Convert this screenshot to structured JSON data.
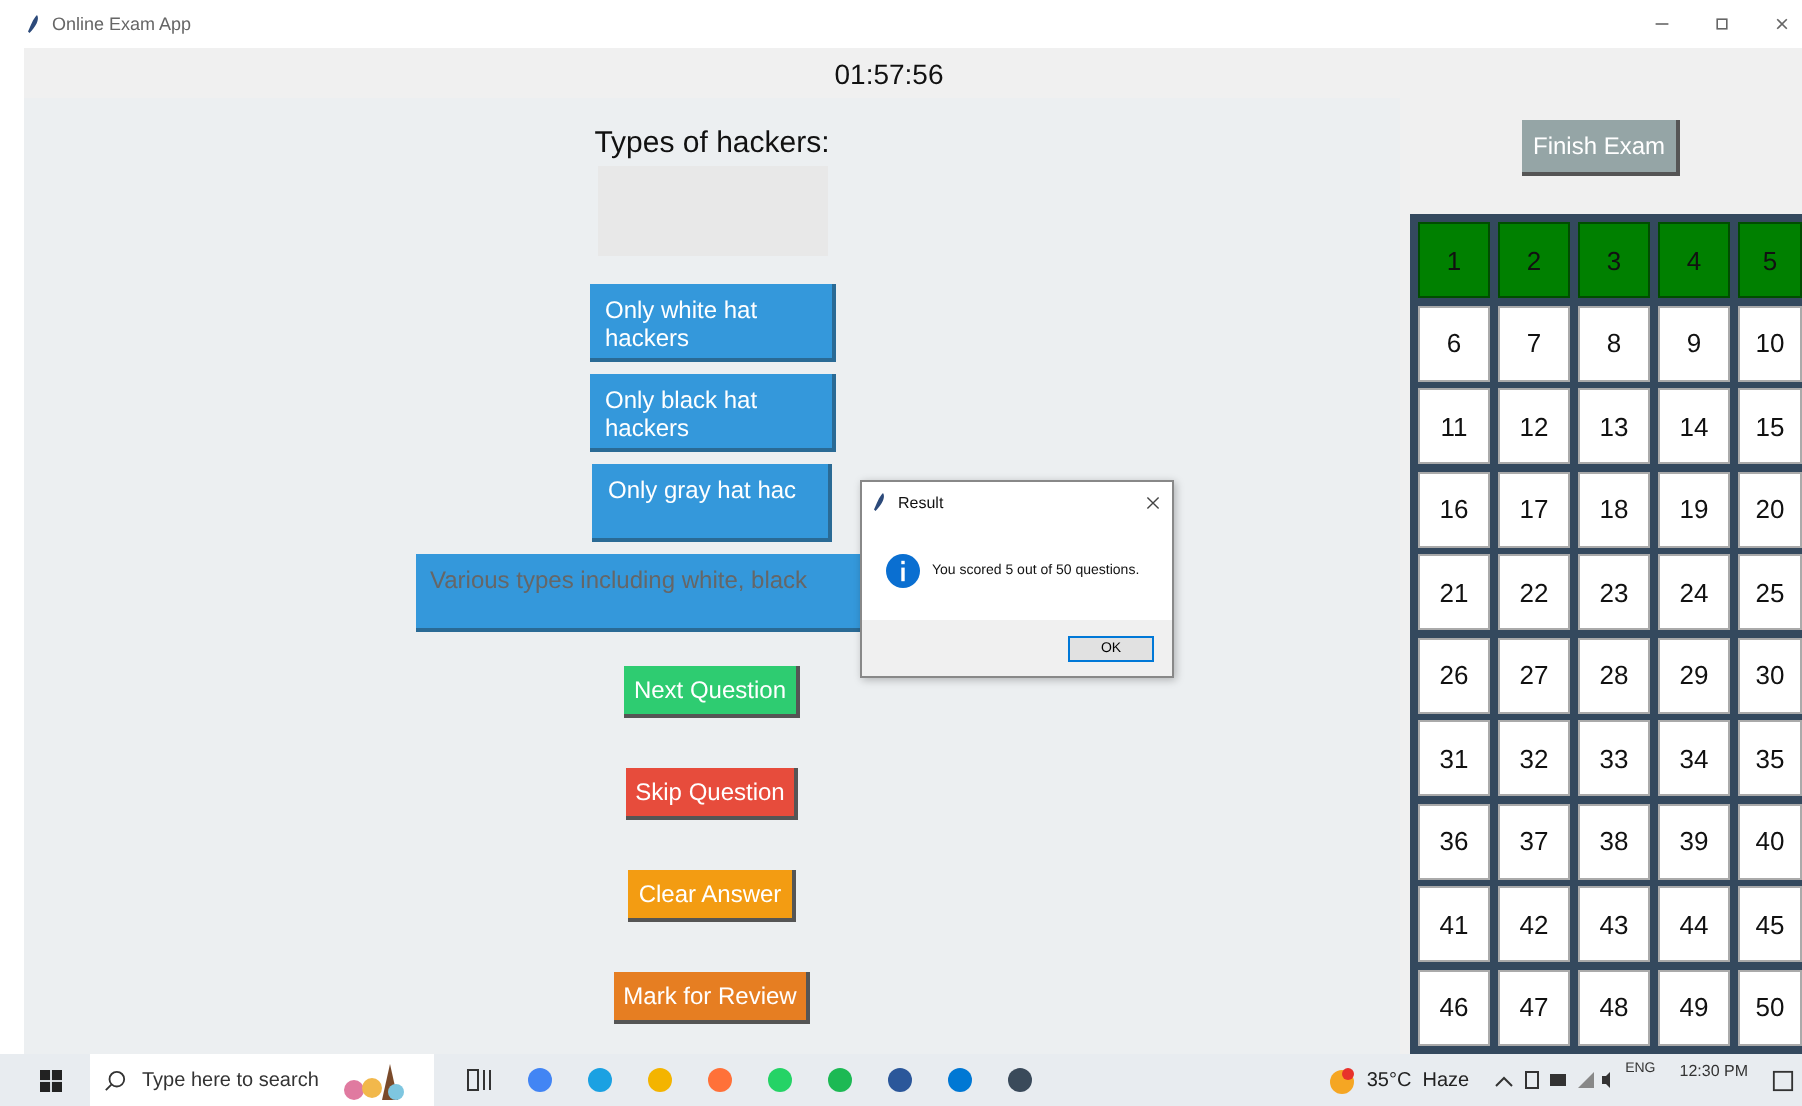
{
  "window": {
    "title": "Online Exam App"
  },
  "timer": "01:57:56",
  "question": "Types of hackers:",
  "options": [
    {
      "label": "Only white hat hackers"
    },
    {
      "label": "Only black hat hackers"
    },
    {
      "label": "Only gray hat hac"
    },
    {
      "label": "Various types including white, black"
    }
  ],
  "actions": [
    {
      "label": "Next Question",
      "kind": "next"
    },
    {
      "label": "Skip Question",
      "kind": "skip"
    },
    {
      "label": "Clear Answer",
      "kind": "clear"
    },
    {
      "label": "Mark for Review",
      "kind": "mark"
    }
  ],
  "finish_button": "Finish Exam",
  "question_grid": [
    {
      "label": "1",
      "answered": true
    },
    {
      "label": "2",
      "answered": true
    },
    {
      "label": "3",
      "answered": true
    },
    {
      "label": "4",
      "answered": true
    },
    {
      "label": "5",
      "answered": true
    },
    {
      "label": "6",
      "answered": false
    },
    {
      "label": "7",
      "answered": false
    },
    {
      "label": "8",
      "answered": false
    },
    {
      "label": "9",
      "answered": false
    },
    {
      "label": "10",
      "answered": false
    },
    {
      "label": "11",
      "answered": false
    },
    {
      "label": "12",
      "answered": false
    },
    {
      "label": "13",
      "answered": false
    },
    {
      "label": "14",
      "answered": false
    },
    {
      "label": "15",
      "answered": false
    },
    {
      "label": "16",
      "answered": false
    },
    {
      "label": "17",
      "answered": false
    },
    {
      "label": "18",
      "answered": false
    },
    {
      "label": "19",
      "answered": false
    },
    {
      "label": "20",
      "answered": false
    },
    {
      "label": "21",
      "answered": false
    },
    {
      "label": "22",
      "answered": false
    },
    {
      "label": "23",
      "answered": false
    },
    {
      "label": "24",
      "answered": false
    },
    {
      "label": "25",
      "answered": false
    },
    {
      "label": "26",
      "answered": false
    },
    {
      "label": "27",
      "answered": false
    },
    {
      "label": "28",
      "answered": false
    },
    {
      "label": "29",
      "answered": false
    },
    {
      "label": "30",
      "answered": false
    },
    {
      "label": "31",
      "answered": false
    },
    {
      "label": "32",
      "answered": false
    },
    {
      "label": "33",
      "answered": false
    },
    {
      "label": "34",
      "answered": false
    },
    {
      "label": "35",
      "answered": false
    },
    {
      "label": "36",
      "answered": false
    },
    {
      "label": "37",
      "answered": false
    },
    {
      "label": "38",
      "answered": false
    },
    {
      "label": "39",
      "answered": false
    },
    {
      "label": "40",
      "answered": false
    },
    {
      "label": "41",
      "answered": false
    },
    {
      "label": "42",
      "answered": false
    },
    {
      "label": "43",
      "answered": false
    },
    {
      "label": "44",
      "answered": false
    },
    {
      "label": "45",
      "answered": false
    },
    {
      "label": "46",
      "answered": false
    },
    {
      "label": "47",
      "answered": false
    },
    {
      "label": "48",
      "answered": false
    },
    {
      "label": "49",
      "answered": false
    },
    {
      "label": "50",
      "answered": false
    }
  ],
  "dialog": {
    "title": "Result",
    "message": "You scored 5 out of 50 questions.",
    "button": "OK"
  },
  "taskbar": {
    "search_placeholder": "Type here to search",
    "weather": "35°C  Haze",
    "language": "ENG",
    "time": "12:30 PM"
  }
}
